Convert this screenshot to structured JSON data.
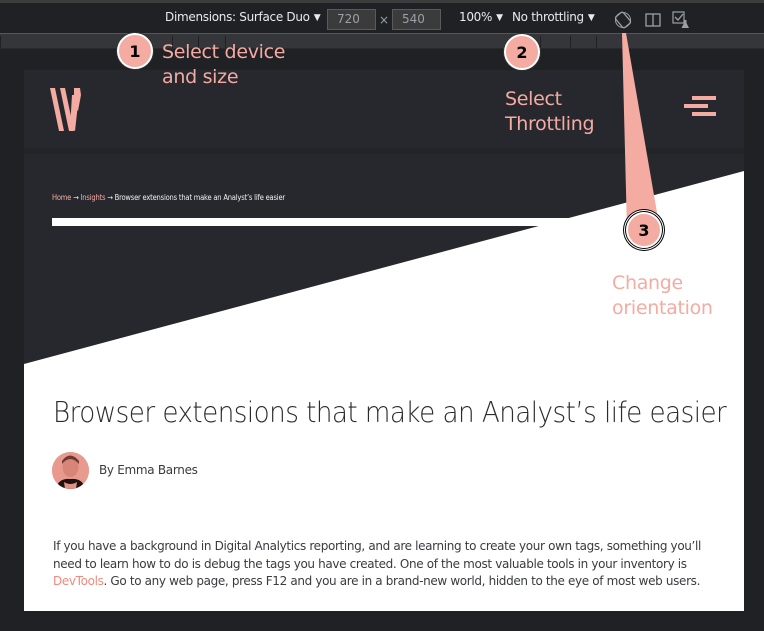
{
  "toolbar": {
    "dimensions_label": "Dimensions: Surface Duo",
    "width_value": "720",
    "times_sign": "×",
    "height_value": "540",
    "zoom_label": "100%",
    "throttling_label": "No throttling",
    "caret": "▼",
    "icons": [
      "rotate-icon",
      "dual-screen-icon",
      "experimental-features-icon"
    ]
  },
  "site": {
    "logo": "W",
    "menu_icon": "hamburger-menu-icon",
    "accent_color": "#f4aba2",
    "breadcrumb": {
      "home": "Home",
      "separator": "→",
      "section": "Insights",
      "current": "Browser extensions that make an Analyst’s life easier"
    },
    "article": {
      "title": "Browser extensions that make an Analyst’s life easier",
      "author": "By Emma Barnes",
      "body_before_link": "If you have a background in Digital Analytics reporting, and are learning to create your own tags, something you’ll need to learn how to do is debug the tags you have created. One of the most valuable tools in your inventory is ",
      "body_link": "DevTools",
      "body_after_link": ". Go to any web page, press F12 and you are in a brand-new world, hidden to the eye of most web users."
    }
  },
  "annotations": [
    {
      "number": "1",
      "text_line1": "Select device",
      "text_line2": "and size"
    },
    {
      "number": "2",
      "text_line1": "Select",
      "text_line2": "Throttling"
    },
    {
      "number": "3",
      "text_line1": "Change",
      "text_line2": "orientation"
    }
  ]
}
